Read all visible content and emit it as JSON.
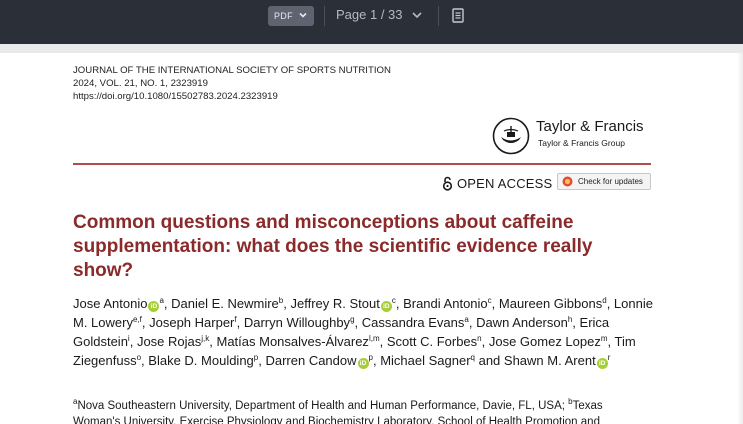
{
  "toolbar": {
    "format_label": "PDF",
    "page_indicator": "Page 1 / 33"
  },
  "journal": {
    "name": "JOURNAL OF THE INTERNATIONAL SOCIETY OF SPORTS NUTRITION",
    "volume": "2024, VOL. 21, NO. 1, 2323919",
    "doi": "https://doi.org/10.1080/15502783.2024.2323919"
  },
  "publisher": {
    "name": "Taylor & Francis",
    "group": "Taylor & Francis Group"
  },
  "open_access_label": "OPEN ACCESS",
  "check_updates_label": "Check for updates",
  "article": {
    "title": "Common questions and misconceptions about caffeine supplementation: what does the scientific evidence really show?",
    "authors": [
      {
        "name": "Jose Antonio",
        "aff": "a",
        "orcid": true
      },
      {
        "name": "Daniel E. Newmire",
        "aff": "b",
        "orcid": false
      },
      {
        "name": "Jeffrey R. Stout",
        "aff": "c",
        "orcid": true
      },
      {
        "name": "Brandi Antonio",
        "aff": "c",
        "orcid": false
      },
      {
        "name": "Maureen Gibbons",
        "aff": "d",
        "orcid": false
      },
      {
        "name": "Lonnie M. Lowery",
        "aff": "e,f",
        "orcid": false
      },
      {
        "name": "Joseph Harper",
        "aff": "f",
        "orcid": false
      },
      {
        "name": "Darryn Willoughby",
        "aff": "g",
        "orcid": false
      },
      {
        "name": "Cassandra Evans",
        "aff": "a",
        "orcid": false
      },
      {
        "name": "Dawn Anderson",
        "aff": "h",
        "orcid": false
      },
      {
        "name": "Erica Goldstein",
        "aff": "i",
        "orcid": false
      },
      {
        "name": "Jose Rojas",
        "aff": "j,k",
        "orcid": false
      },
      {
        "name": "Matías Monsalves-Álvarez",
        "aff": "l,m",
        "orcid": false
      },
      {
        "name": "Scott C. Forbes",
        "aff": "n",
        "orcid": false
      },
      {
        "name": "Jose Gomez Lopez",
        "aff": "m",
        "orcid": false
      },
      {
        "name": "Tim Ziegenfuss",
        "aff": "o",
        "orcid": false
      },
      {
        "name": "Blake D. Moulding",
        "aff": "p",
        "orcid": false
      },
      {
        "name": "Darren Candow",
        "aff": "p",
        "orcid": true
      },
      {
        "name": "Michael Sagner",
        "aff": "q",
        "orcid": false
      },
      {
        "name": "Shawn M. Arent",
        "aff": "r",
        "orcid": true
      }
    ],
    "and_word": "and",
    "affiliation_line1_sup_a": "a",
    "affiliation_line1_a": "Nova Southeastern University, Department of Health and Human Performance, Davie, FL, USA; ",
    "affiliation_line1_sup_b": "b",
    "affiliation_line1_b": "Texas",
    "affiliation_line2": "Woman's University, Exercise Physiology and Biochemistry Laboratory, School of Health Promotion and"
  },
  "icons": {
    "orcid_glyph": "iD"
  },
  "colors": {
    "toolbar_bg": "#2b2f38",
    "title_red": "#8b2a2a",
    "rule_red": "#b24b4b",
    "orcid_green": "#a6ce39"
  }
}
